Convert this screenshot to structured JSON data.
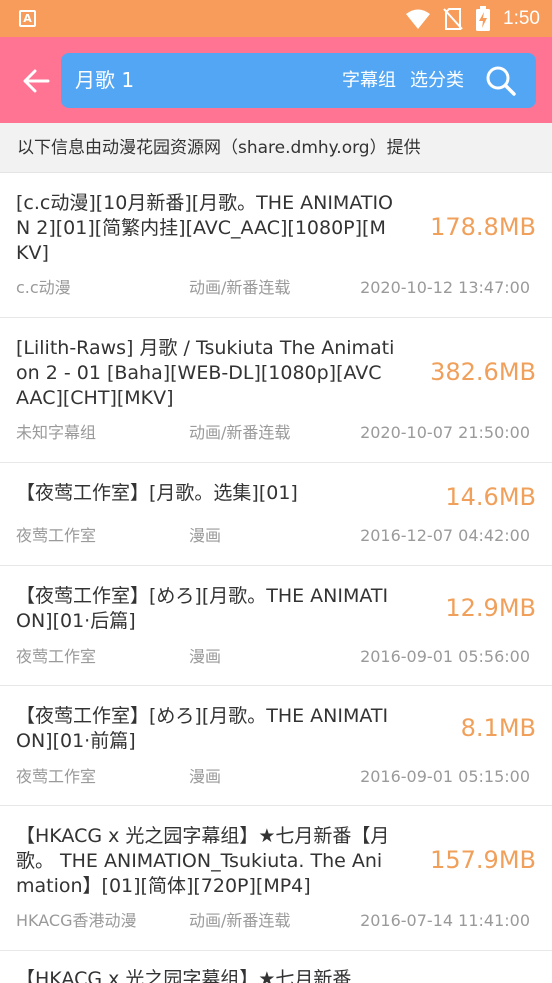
{
  "status_bar": {
    "app_icon_letter": "A",
    "time": "1:50"
  },
  "header": {
    "search_query": "月歌 1",
    "subtitle_group_label": "字幕组",
    "category_label": "选分类"
  },
  "info_banner": "以下信息由动漫花园资源网（share.dmhy.org）提供",
  "results": [
    {
      "title": "[c.c动漫][10月新番][月歌。THE ANIMATION 2][01][简繁内挂][AVC_AAC][1080P][MKV]",
      "size": "178.8MB",
      "group": "c.c动漫",
      "category": "动画/新番连载",
      "date": "2020-10-12 13:47:00"
    },
    {
      "title": "[Lilith-Raws] 月歌 / Tsukiuta The Animation 2 - 01 [Baha][WEB-DL][1080p][AVC AAC][CHT][MKV]",
      "size": "382.6MB",
      "group": "未知字幕组",
      "category": "动画/新番连载",
      "date": "2020-10-07 21:50:00"
    },
    {
      "title": "【夜莺工作室】[月歌。选集][01]",
      "size": "14.6MB",
      "group": "夜莺工作室",
      "category": "漫画",
      "date": "2016-12-07 04:42:00"
    },
    {
      "title": "【夜莺工作室】[めろ][月歌。THE ANIMATION][01·后篇]",
      "size": "12.9MB",
      "group": "夜莺工作室",
      "category": "漫画",
      "date": "2016-09-01 05:56:00"
    },
    {
      "title": "【夜莺工作室】[めろ][月歌。THE ANIMATION][01·前篇]",
      "size": "8.1MB",
      "group": "夜莺工作室",
      "category": "漫画",
      "date": "2016-09-01 05:15:00"
    },
    {
      "title": "【HKACG x 光之园字幕组】★七月新番【月歌。 THE ANIMATION_Tsukiuta. The Animation】[01][简体][720P][MP4]",
      "size": "157.9MB",
      "group": "HKACG香港动漫",
      "category": "动画/新番连载",
      "date": "2016-07-14 11:41:00"
    },
    {
      "title": "【HKACG x 光之园字幕组】★七月新番",
      "size": "",
      "group": "",
      "category": "",
      "date": ""
    }
  ],
  "colors": {
    "status_bar": "#f79c5a",
    "header": "#ff7393",
    "search_box": "#53a6f3",
    "size_text": "#f0a05a"
  }
}
